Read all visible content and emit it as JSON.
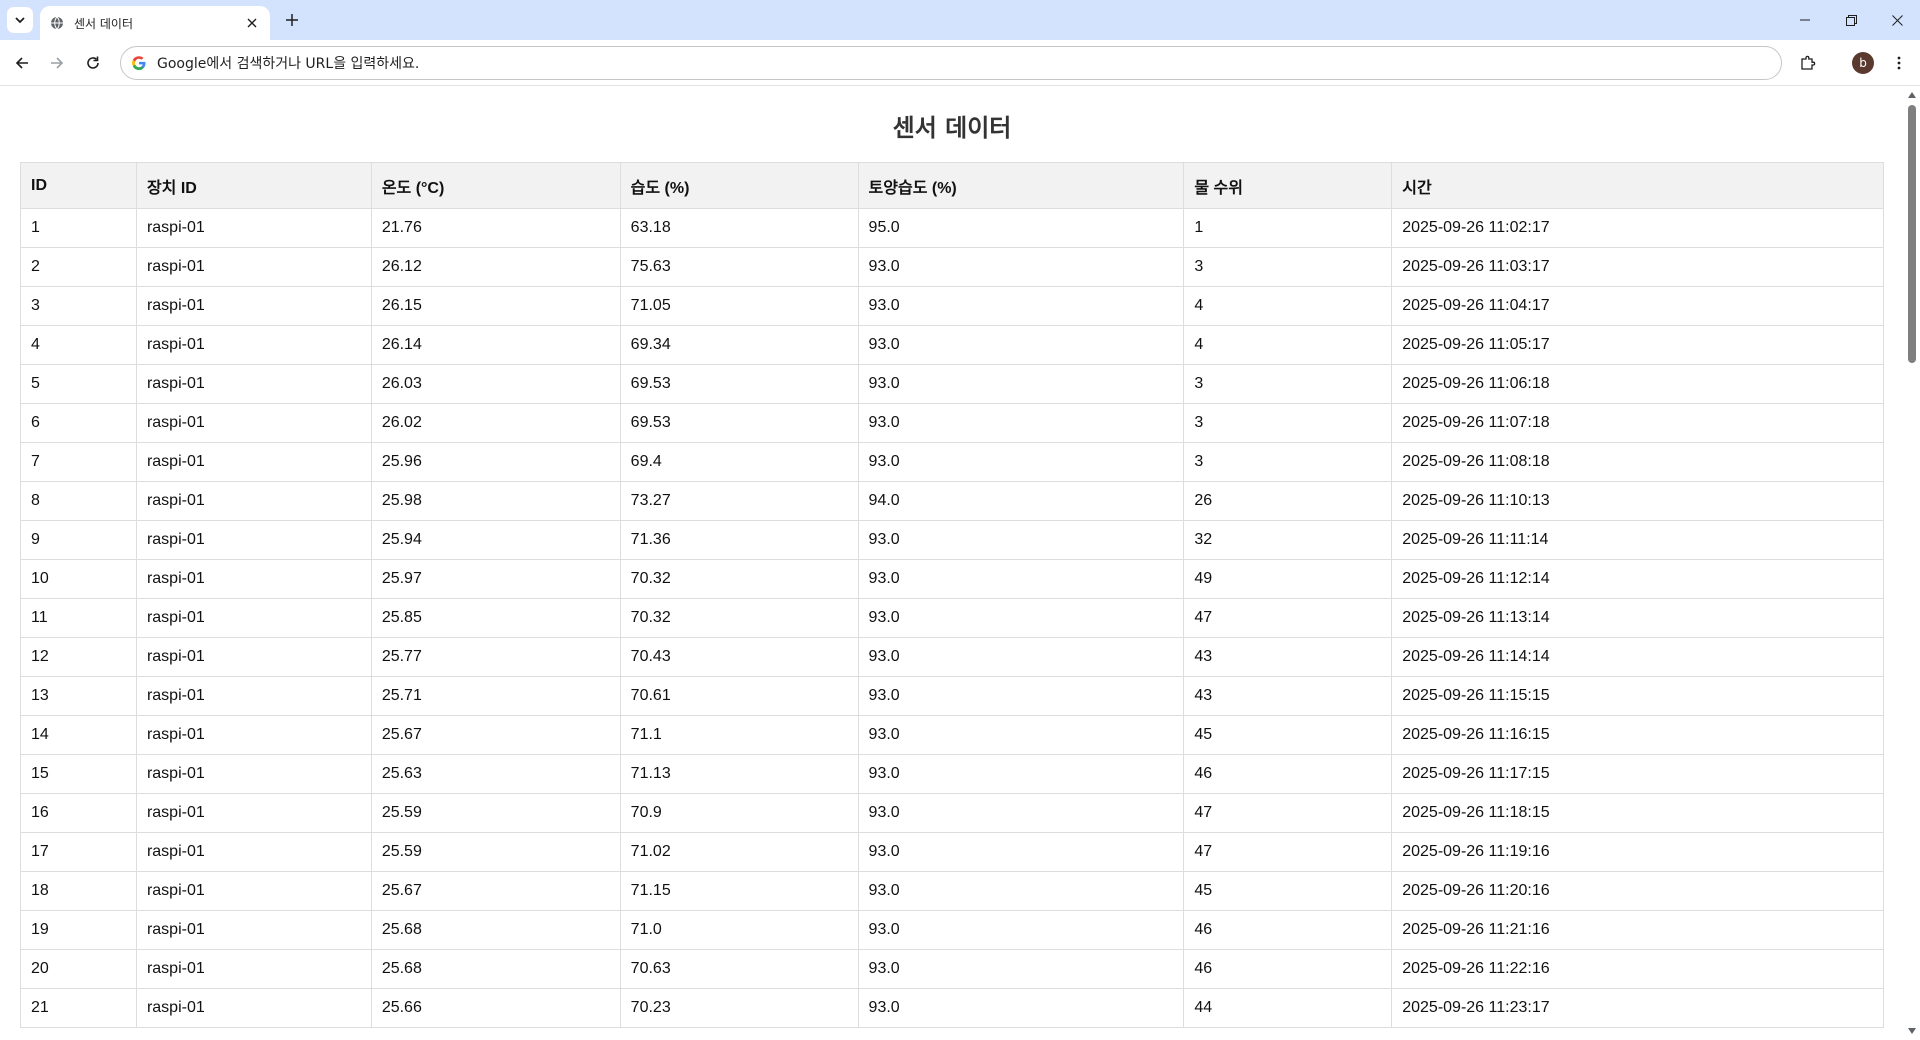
{
  "browser": {
    "tab_title": "센서 데이터",
    "address_placeholder": "Google에서 검색하거나 URL을 입력하세요.",
    "profile_initial": "b"
  },
  "page": {
    "title": "센서 데이터",
    "columns": [
      "ID",
      "장치 ID",
      "온도 (°C)",
      "습도 (%)",
      "토양습도 (%)",
      "물 수위",
      "시간"
    ],
    "rows": [
      [
        "1",
        "raspi-01",
        "21.76",
        "63.18",
        "95.0",
        "1",
        "2025-09-26 11:02:17"
      ],
      [
        "2",
        "raspi-01",
        "26.12",
        "75.63",
        "93.0",
        "3",
        "2025-09-26 11:03:17"
      ],
      [
        "3",
        "raspi-01",
        "26.15",
        "71.05",
        "93.0",
        "4",
        "2025-09-26 11:04:17"
      ],
      [
        "4",
        "raspi-01",
        "26.14",
        "69.34",
        "93.0",
        "4",
        "2025-09-26 11:05:17"
      ],
      [
        "5",
        "raspi-01",
        "26.03",
        "69.53",
        "93.0",
        "3",
        "2025-09-26 11:06:18"
      ],
      [
        "6",
        "raspi-01",
        "26.02",
        "69.53",
        "93.0",
        "3",
        "2025-09-26 11:07:18"
      ],
      [
        "7",
        "raspi-01",
        "25.96",
        "69.4",
        "93.0",
        "3",
        "2025-09-26 11:08:18"
      ],
      [
        "8",
        "raspi-01",
        "25.98",
        "73.27",
        "94.0",
        "26",
        "2025-09-26 11:10:13"
      ],
      [
        "9",
        "raspi-01",
        "25.94",
        "71.36",
        "93.0",
        "32",
        "2025-09-26 11:11:14"
      ],
      [
        "10",
        "raspi-01",
        "25.97",
        "70.32",
        "93.0",
        "49",
        "2025-09-26 11:12:14"
      ],
      [
        "11",
        "raspi-01",
        "25.85",
        "70.32",
        "93.0",
        "47",
        "2025-09-26 11:13:14"
      ],
      [
        "12",
        "raspi-01",
        "25.77",
        "70.43",
        "93.0",
        "43",
        "2025-09-26 11:14:14"
      ],
      [
        "13",
        "raspi-01",
        "25.71",
        "70.61",
        "93.0",
        "43",
        "2025-09-26 11:15:15"
      ],
      [
        "14",
        "raspi-01",
        "25.67",
        "71.1",
        "93.0",
        "45",
        "2025-09-26 11:16:15"
      ],
      [
        "15",
        "raspi-01",
        "25.63",
        "71.13",
        "93.0",
        "46",
        "2025-09-26 11:17:15"
      ],
      [
        "16",
        "raspi-01",
        "25.59",
        "70.9",
        "93.0",
        "47",
        "2025-09-26 11:18:15"
      ],
      [
        "17",
        "raspi-01",
        "25.59",
        "71.02",
        "93.0",
        "47",
        "2025-09-26 11:19:16"
      ],
      [
        "18",
        "raspi-01",
        "25.67",
        "71.15",
        "93.0",
        "45",
        "2025-09-26 11:20:16"
      ],
      [
        "19",
        "raspi-01",
        "25.68",
        "71.0",
        "93.0",
        "46",
        "2025-09-26 11:21:16"
      ],
      [
        "20",
        "raspi-01",
        "25.68",
        "70.63",
        "93.0",
        "46",
        "2025-09-26 11:22:16"
      ],
      [
        "21",
        "raspi-01",
        "25.66",
        "70.23",
        "93.0",
        "44",
        "2025-09-26 11:23:17"
      ]
    ]
  }
}
